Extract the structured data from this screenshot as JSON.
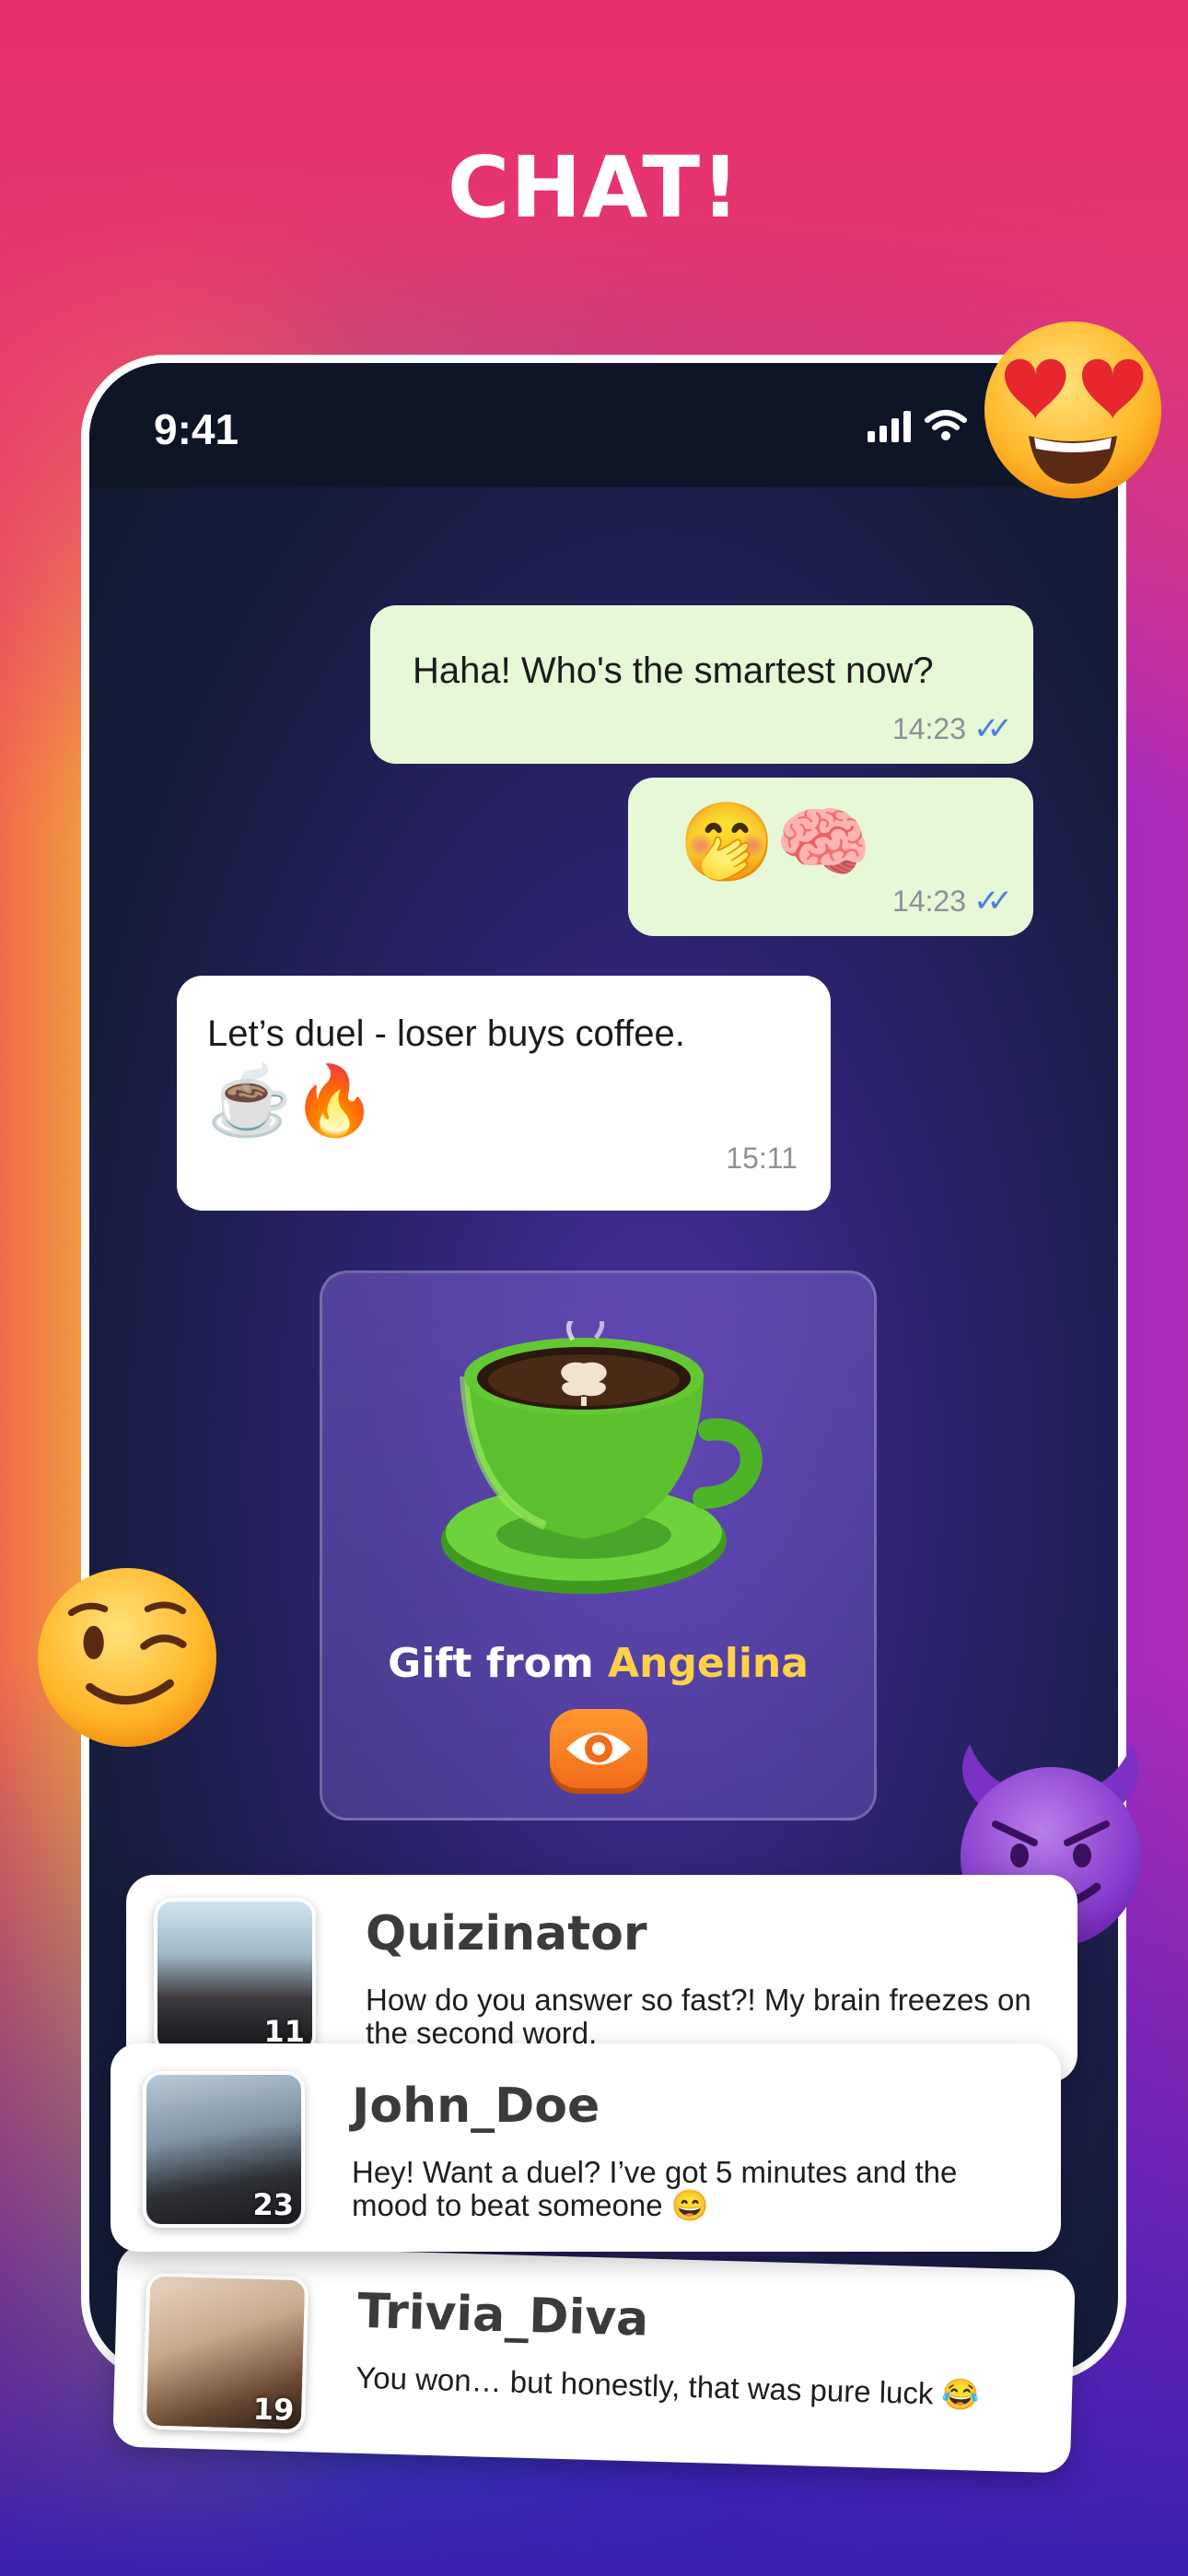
{
  "headline": "CHAT!",
  "status_bar": {
    "time": "9:41"
  },
  "messages": [
    {
      "direction": "out",
      "text": "Haha! Who's the smartest now?",
      "time": "14:23",
      "read": true
    },
    {
      "direction": "out",
      "emojis": "🤭🧠",
      "time": "14:23",
      "read": true
    },
    {
      "direction": "in",
      "text": "Let’s duel - loser buys coffee.",
      "emojis": "☕🔥",
      "time": "15:11"
    }
  ],
  "gift": {
    "label_prefix": "Gift from",
    "sender": "Angelina",
    "view_icon": "eye-icon"
  },
  "chats": [
    {
      "name": "Quizinator",
      "message": "How do you answer so fast?! My brain freezes on the second word.",
      "level": "11"
    },
    {
      "name": "John_Doe",
      "message": "Hey! Want a duel? I’ve got 5 minutes and the mood to beat someone 😄",
      "level": "23"
    },
    {
      "name": "Trivia_Diva",
      "message": "You won… but honestly, that was pure luck 😂",
      "level": "19"
    }
  ],
  "decor": {
    "emojis": [
      "heart-eyes-emoji",
      "wink-emoji",
      "smiling-devil-emoji"
    ],
    "colors": {
      "pink": "#e72f6d",
      "bubble_out": "#e6f8d6",
      "gift_name": "#ffd24a",
      "button": "#f26b1a"
    }
  }
}
